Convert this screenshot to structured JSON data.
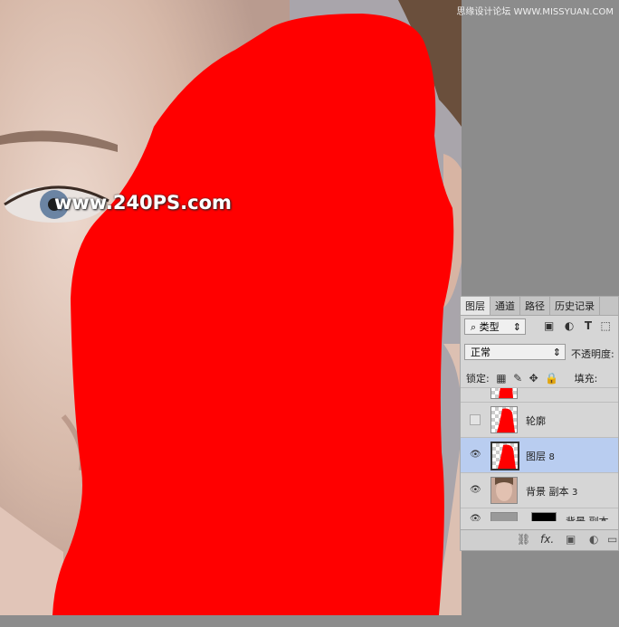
{
  "watermarks": {
    "top_right": "思缘设计论坛 WWW.MISSYUAN.COM",
    "center": "www.240PS.com"
  },
  "layers_panel": {
    "tabs": [
      "图层",
      "通道",
      "路径",
      "历史记录"
    ],
    "filter_kind": "类型",
    "blend_mode": "正常",
    "opacity_label": "不透明度:",
    "lock_label": "锁定:",
    "fill_label": "填充:",
    "layers": [
      {
        "name": "轮廓",
        "suffix": "",
        "visible": false,
        "selected": false
      },
      {
        "name": "图层",
        "suffix": "8",
        "visible": true,
        "selected": true
      },
      {
        "name": "背景 副本",
        "suffix": "3",
        "visible": true,
        "selected": false
      },
      {
        "name": "背景 副本",
        "suffix": "",
        "visible": true,
        "selected": false
      }
    ],
    "bottom_icons": [
      "link-icon",
      "fx-icon",
      "mask-icon",
      "adjustment-icon",
      "folder-icon"
    ],
    "fx_label": "fx."
  },
  "colors": {
    "mask_red": "#ff0000",
    "selected_layer": "#b9cdf0"
  }
}
